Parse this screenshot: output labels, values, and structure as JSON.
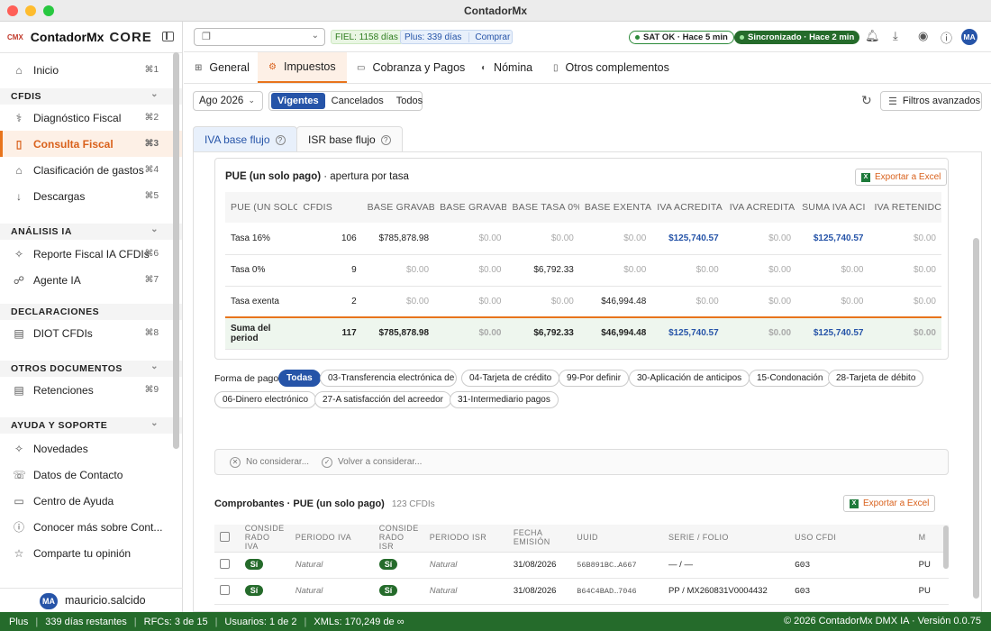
{
  "window": {
    "title": "ContadorMx"
  },
  "brand": {
    "logo": "CMX",
    "name": "ContadorMx",
    "edition": "CORE"
  },
  "sidebar": {
    "inicio": {
      "label": "Inicio",
      "kbd": "⌘1"
    },
    "sections": [
      {
        "title": "CFDIS",
        "items": [
          {
            "label": "Diagnóstico Fiscal",
            "kbd": "⌘2"
          },
          {
            "label": "Consulta Fiscal",
            "kbd": "⌘3"
          },
          {
            "label": "Clasificación de gastos",
            "kbd": "⌘4"
          },
          {
            "label": "Descargas",
            "kbd": "⌘5"
          }
        ]
      },
      {
        "title": "ANÁLISIS IA",
        "items": [
          {
            "label": "Reporte Fiscal IA CFDIs",
            "kbd": "⌘6"
          },
          {
            "label": "Agente IA",
            "kbd": "⌘7"
          }
        ]
      },
      {
        "title": "DECLARACIONES",
        "items": [
          {
            "label": "DIOT CFDIs",
            "kbd": "⌘8"
          }
        ]
      },
      {
        "title": "OTROS DOCUMENTOS",
        "items": [
          {
            "label": "Retenciones",
            "kbd": "⌘9"
          }
        ]
      },
      {
        "title": "AYUDA Y SOPORTE",
        "items": [
          {
            "label": "Novedades"
          },
          {
            "label": "Datos de Contacto"
          },
          {
            "label": "Centro de Ayuda"
          },
          {
            "label": "Conocer más sobre Cont..."
          },
          {
            "label": "Comparte tu opinión"
          }
        ]
      }
    ],
    "user": {
      "initials": "MA",
      "name": "mauricio.salcido"
    }
  },
  "topbar": {
    "fiel": "FIEL: 1158 días",
    "plus": "Plus: 339 días",
    "buy": "Comprar",
    "sat": "SAT OK · Hace 5 min",
    "sync": "Sincronizado · Hace 2 min",
    "avatar": "MA"
  },
  "tabs": [
    "General",
    "Impuestos",
    "Cobranza y Pagos",
    "Nómina",
    "Otros complementos"
  ],
  "filters": {
    "month": "Ago 2026",
    "segments": [
      "Vigentes",
      "Cancelados",
      "Todos"
    ],
    "advanced": "Filtros avanzados"
  },
  "subtabs": [
    "IVA base flujo",
    "ISR base flujo"
  ],
  "pue_card": {
    "title": "PUE (un solo pago)",
    "subtitle": "· apertura por tasa",
    "export": "Exportar a Excel",
    "headers": [
      "PUE (UN SOLO",
      "CFDIS",
      "BASE GRAVAB",
      "BASE GRAVAB",
      "BASE TASA 0%",
      "BASE EXENTA",
      "IVA ACREDITA",
      "IVA ACREDITA",
      "SUMA IVA ACI",
      "IVA RETENIDC"
    ],
    "rows": [
      [
        "Tasa 16%",
        "106",
        "$785,878.98",
        "$0.00",
        "$0.00",
        "$0.00",
        "$125,740.57",
        "$0.00",
        "$125,740.57",
        "$0.00"
      ],
      [
        "Tasa 0%",
        "9",
        "$0.00",
        "$0.00",
        "$6,792.33",
        "$0.00",
        "$0.00",
        "$0.00",
        "$0.00",
        "$0.00"
      ],
      [
        "Tasa exenta",
        "2",
        "$0.00",
        "$0.00",
        "$0.00",
        "$46,994.48",
        "$0.00",
        "$0.00",
        "$0.00",
        "$0.00"
      ]
    ],
    "total": [
      "Suma del period",
      "117",
      "$785,878.98",
      "$0.00",
      "$6,792.33",
      "$46,994.48",
      "$125,740.57",
      "$0.00",
      "$125,740.57",
      "$0.00"
    ]
  },
  "forma_pago": {
    "label": "Forma de pago",
    "chips": [
      "Todas",
      "03-Transferencia electrónica de fo",
      "04-Tarjeta de crédito",
      "99-Por definir",
      "30-Aplicación de anticipos",
      "15-Condonación",
      "28-Tarjeta de débito",
      "06-Dinero electrónico",
      "27-A satisfacción del acreedor",
      "31-Intermediario pagos"
    ]
  },
  "consider": {
    "no": "No considerar...",
    "yes": "Volver a considerar..."
  },
  "comprobantes": {
    "title": "Comprobantes · PUE (un solo pago)",
    "count": "123 CFDIs",
    "export": "Exportar a Excel",
    "headers": [
      "CONSIDE\nRADO IVA",
      "PERIODO IVA",
      "CONSIDE\nRADO ISR",
      "PERIODO ISR",
      "FECHA\nEMISIÓN",
      "UUID",
      "SERIE / FOLIO",
      "USO CFDI",
      "M"
    ],
    "rows": [
      {
        "iva": "Sí",
        "piva": "Natural",
        "isr": "Sí",
        "pisr": "Natural",
        "fecha": "31/08/2026",
        "uuid": "56B891BC…A667",
        "serie": "— / —",
        "uso": "G03",
        "m": "PU"
      },
      {
        "iva": "Sí",
        "piva": "Natural",
        "isr": "Sí",
        "pisr": "Natural",
        "fecha": "31/08/2026",
        "uuid": "B64C4BAD…7046",
        "serie": "PP / MX260831V0004432",
        "uso": "G03",
        "m": "PU"
      },
      {
        "iva": "Sí",
        "piva": "Natural",
        "isr": "Sí",
        "pisr": "Natural",
        "fecha": "31/08/2026",
        "uuid": "68F4351C…1552",
        "serie": "— / 0353113598",
        "uso": "G03",
        "m": "PU"
      }
    ]
  },
  "status": {
    "plan": "Plus",
    "days": "339 días restantes",
    "rfcs": "RFCs: 3 de 15",
    "users": "Usuarios: 1 de 2",
    "xmls": "XMLs: 170,249 de ∞",
    "copyright": "© 2026 ContadorMx DMX IA · Versión 0.0.75"
  },
  "colors": {
    "accent": "#e8741c",
    "primary": "#2654a8",
    "success": "#256b2b"
  }
}
